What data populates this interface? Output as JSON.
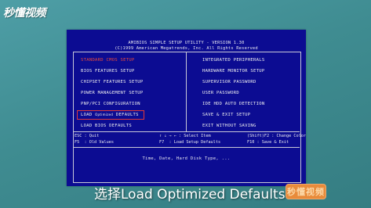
{
  "logo": {
    "text": "秒懂视频"
  },
  "bios": {
    "title_line1": "AMIBIOS SIMPLE SETUP UTILITY - VERSION 1.30",
    "title_line2": "(C)1999 American Megatrends, Inc. All Rights Reserved",
    "left_menu": [
      {
        "label": "STANDARD CMOS SETUP"
      },
      {
        "label": "BIOS FEATURES SETUP"
      },
      {
        "label": "CHIPSET FEATURES SETUP"
      },
      {
        "label": "POWER MANAGEMENT SETUP"
      },
      {
        "label": "PNP/PCI CONFIGURATION"
      },
      {
        "prefix": "LOAD",
        "small": "Optimized",
        "suffix": "DEFAULTS"
      },
      {
        "label": "LOAD BIOS DEFAULTS"
      }
    ],
    "right_menu": [
      {
        "label": "INTEGRATED PERIPHERALS"
      },
      {
        "label": "HARDWARE MONITOR SETUP"
      },
      {
        "label": "SUPERVISOR PASSWORD"
      },
      {
        "label": "USER PASSWORD"
      },
      {
        "label": "IDE HDD AUTO DETECTION"
      },
      {
        "label": "SAVE & EXIT SETUP"
      },
      {
        "label": "EXIT WITHOUT SAVING"
      }
    ],
    "keys": {
      "esc": "ESC : Quit",
      "f5": "F5  : Old Values",
      "arrows": "↑ ↓ → ← : Select Item",
      "f7": "F7  : Load Setup Defaults",
      "shift_f2": "(Shift)F2 : Change Color",
      "f10": "F10 : Save & Exit"
    },
    "hint": "Time, Date, Hard Disk Type, ..."
  },
  "caption": {
    "text": "选择Load Optimized Defaults"
  },
  "badge": {
    "text": "秒懂视频"
  },
  "colors": {
    "screen_bg": "#0c0c92",
    "selected_red": "#e84a3a",
    "badge_orange": "#e88b3b",
    "page_bg": "#3f8e93"
  }
}
